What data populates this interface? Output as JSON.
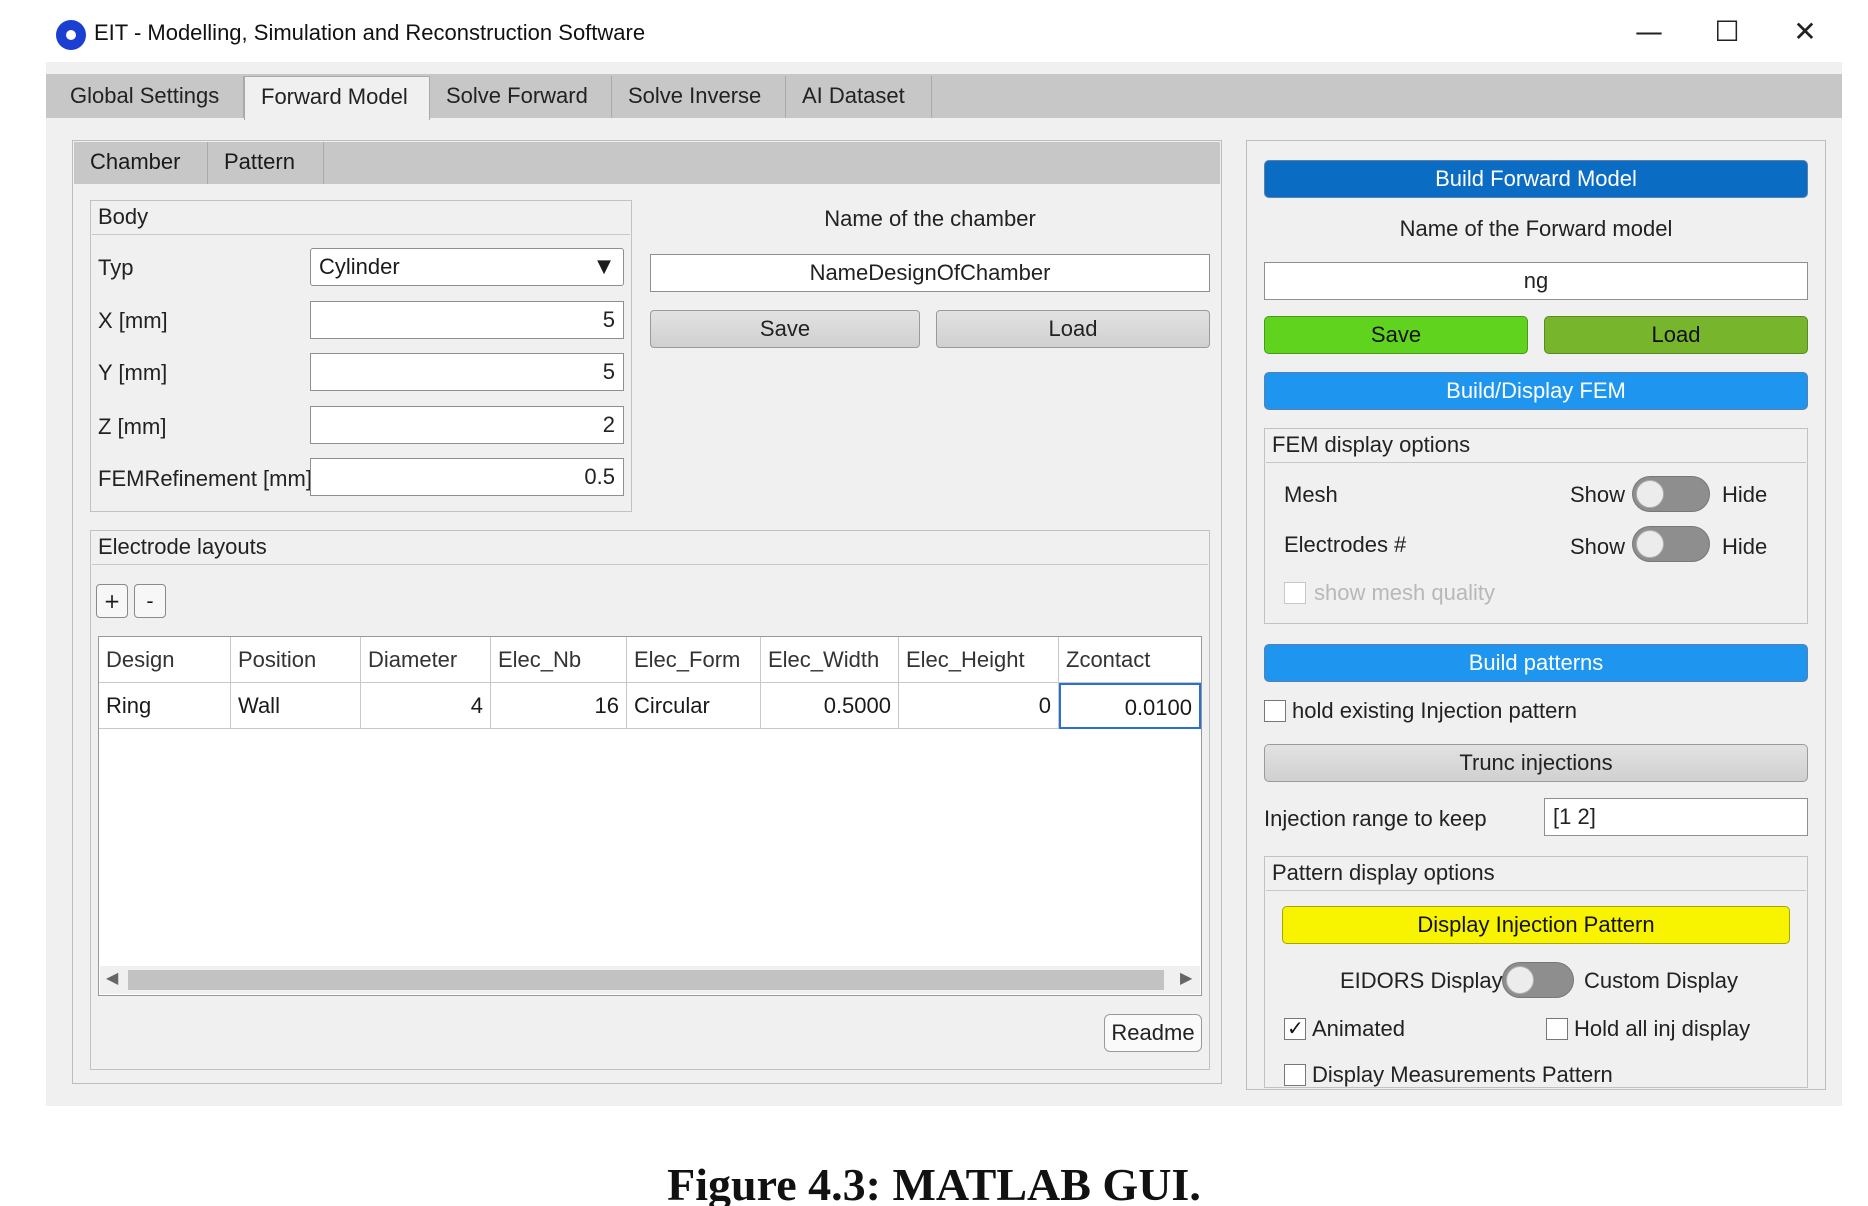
{
  "window": {
    "title": "EIT - Modelling, Simulation and Reconstruction Software",
    "minimize": "—",
    "maximize": "☐",
    "close": "✕"
  },
  "main_tabs": [
    "Global Settings",
    "Forward Model",
    "Solve Forward",
    "Solve Inverse",
    "AI Dataset"
  ],
  "sub_tabs": [
    "Chamber",
    "Pattern"
  ],
  "body": {
    "title": "Body",
    "typ_label": "Typ",
    "typ_value": "Cylinder",
    "x_label": "X [mm]",
    "x_value": "5",
    "y_label": "Y [mm]",
    "y_value": "5",
    "z_label": "Z [mm]",
    "z_value": "2",
    "fem_label": "FEMRefinement [mm]",
    "fem_value": "0.5"
  },
  "chamber": {
    "name_label": "Name of the chamber",
    "name_value": "NameDesignOfChamber",
    "save": "Save",
    "load": "Load"
  },
  "electrodes": {
    "title": "Electrode layouts",
    "add": "+",
    "remove": "-",
    "columns": [
      "Design",
      "Position",
      "Diameter",
      "Elec_Nb",
      "Elec_Form",
      "Elec_Width",
      "Elec_Height",
      "Zcontact"
    ],
    "rows": [
      [
        "Ring",
        "Wall",
        "4",
        "16",
        "Circular",
        "0.5000",
        "0",
        "0.0100"
      ]
    ],
    "readme": "Readme"
  },
  "forward": {
    "build_model": "Build Forward Model",
    "name_label": "Name of the Forward model",
    "name_value": "ng",
    "save": "Save",
    "load": "Load",
    "build_fem": "Build/Display FEM",
    "fem_options_title": "FEM display options",
    "mesh_label": "Mesh",
    "electrodes_label": "Electrodes #",
    "show": "Show",
    "hide": "Hide",
    "mesh_quality": "show mesh quality",
    "build_patterns": "Build patterns",
    "hold_injection": "hold existing Injection pattern",
    "trunc": "Trunc injections",
    "range_label": "Injection range to keep",
    "range_value": "[1 2]",
    "pattern_options_title": "Pattern display options",
    "display_injection": "Display Injection Pattern",
    "eidors": "EIDORS Display",
    "custom": "Custom Display",
    "animated": "Animated",
    "hold_all": "Hold all inj display",
    "display_meas": "Display Measurements Pattern"
  },
  "colors": {
    "build_blue": "#0b6cc4",
    "fem_blue": "#1e96f0",
    "save_green": "#5fd31e",
    "load_green": "#77b52c",
    "yellow": "#f8f400"
  },
  "caption": "Figure 4.3: MATLAB GUI."
}
